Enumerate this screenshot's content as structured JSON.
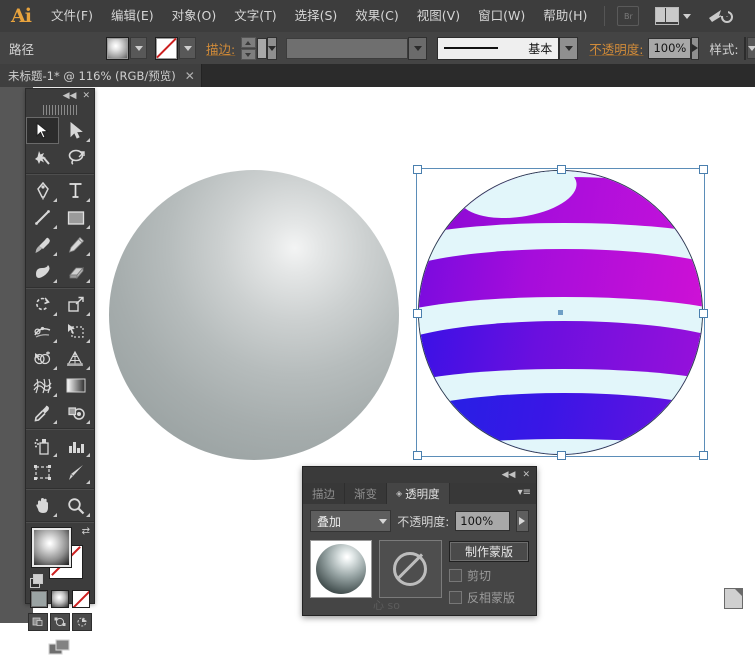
{
  "app": {
    "name": "Adobe Illustrator",
    "logo_text": "Ai"
  },
  "menubar": {
    "items": [
      {
        "label": "文件(F)"
      },
      {
        "label": "编辑(E)"
      },
      {
        "label": "对象(O)"
      },
      {
        "label": "文字(T)"
      },
      {
        "label": "选择(S)"
      },
      {
        "label": "效果(C)"
      },
      {
        "label": "视图(V)"
      },
      {
        "label": "窗口(W)"
      },
      {
        "label": "帮助(H)"
      }
    ],
    "bridge_label": "Br",
    "arrange_icon": "arrange-documents-icon",
    "workspace_icon": "workspace-switcher-icon"
  },
  "controlbar": {
    "object_type": "路径",
    "fill_swatch": "radial-gradient-swatch",
    "stroke_swatch": "none-swatch",
    "stroke_label": "描边:",
    "stroke_weight": "",
    "stroke_profile": "",
    "brush_label": "基本",
    "opacity_label": "不透明度:",
    "opacity_value": "100%",
    "style_label": "样式:",
    "style_swatch": "graphic-style-swatch"
  },
  "tabbar": {
    "document_tab": "未标题-1* @ 116% (RGB/预览)",
    "close_glyph": "✕"
  },
  "toolpanel": {
    "collapse_glyph": "◀◀",
    "close_glyph": "✕",
    "tools": [
      {
        "name": "selection-tool",
        "active": true
      },
      {
        "name": "direct-selection-tool",
        "active": false
      },
      {
        "name": "magic-wand-tool",
        "active": false
      },
      {
        "name": "lasso-tool",
        "active": false
      },
      {
        "name": "pen-tool",
        "active": false
      },
      {
        "name": "type-tool",
        "active": false
      },
      {
        "name": "line-segment-tool",
        "active": false
      },
      {
        "name": "rectangle-tool",
        "active": false
      },
      {
        "name": "paintbrush-tool",
        "active": false
      },
      {
        "name": "pencil-tool",
        "active": false
      },
      {
        "name": "blob-brush-tool",
        "active": false
      },
      {
        "name": "eraser-tool",
        "active": false
      },
      {
        "name": "rotate-tool",
        "active": false
      },
      {
        "name": "scale-tool",
        "active": false
      },
      {
        "name": "width-tool",
        "active": false
      },
      {
        "name": "free-transform-tool",
        "active": false
      },
      {
        "name": "shape-builder-tool",
        "active": false
      },
      {
        "name": "perspective-grid-tool",
        "active": false
      },
      {
        "name": "mesh-tool",
        "active": false
      },
      {
        "name": "gradient-tool",
        "active": false
      },
      {
        "name": "eyedropper-tool",
        "active": false
      },
      {
        "name": "blend-tool",
        "active": false
      },
      {
        "name": "symbol-sprayer-tool",
        "active": false
      },
      {
        "name": "column-graph-tool",
        "active": false
      },
      {
        "name": "artboard-tool",
        "active": false
      },
      {
        "name": "slice-tool",
        "active": false
      },
      {
        "name": "hand-tool",
        "active": false
      },
      {
        "name": "zoom-tool",
        "active": false
      }
    ],
    "fill_indicator": "radial-gradient-fill",
    "stroke_indicator": "none-stroke",
    "color_modes": [
      "color-mode-button",
      "gradient-mode-button",
      "none-mode-button"
    ],
    "draw_modes": [
      "draw-normal-button",
      "draw-behind-button",
      "draw-inside-button"
    ],
    "screen_mode": "screen-mode-button"
  },
  "transparency_panel": {
    "collapse_glyph": "◀◀",
    "close_glyph": "✕",
    "menu_glyph": "▾≡",
    "tabs": [
      {
        "label": "描边",
        "active": false
      },
      {
        "label": "渐变",
        "active": false
      },
      {
        "label": "透明度",
        "active": true
      }
    ],
    "blend_mode": "叠加",
    "opacity_label": "不透明度:",
    "opacity_value": "100%",
    "thumbnail": "sphere-thumbnail",
    "mask_thumbnail": "no-mask-symbol",
    "make_mask_button": "制作蒙版",
    "clip_checkbox": "剪切",
    "invert_mask_checkbox": "反相蒙版",
    "watermark": "心 so"
  },
  "canvas": {
    "gray_sphere": {
      "name": "gray-sphere-artwork",
      "highlight": "#f3f4f4",
      "midtone": "#b6bcbc",
      "shadow": "#959d9e"
    },
    "striped_sphere": {
      "name": "striped-sphere-artwork",
      "base_color": "#e2f6fa",
      "band_colors": [
        "#8a0ad6",
        "#c612d8",
        "#3a12e8",
        "#9a10d8",
        "#2a1ae6",
        "#1228e0"
      ],
      "selected": true,
      "handle_count": 8
    }
  }
}
